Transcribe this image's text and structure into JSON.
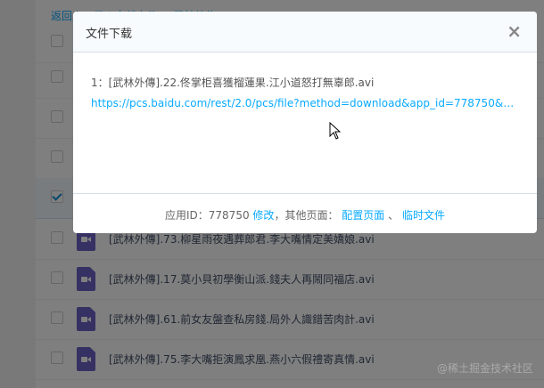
{
  "breadcrumb": "返回上一级 | 全部文件 > 武林外传",
  "rows": [
    {
      "name": "",
      "checked": false
    },
    {
      "name": "",
      "checked": false
    },
    {
      "name": "",
      "checked": false
    },
    {
      "name": "",
      "checked": false
    },
    {
      "name": "",
      "checked": true
    },
    {
      "name": "[武林外傳].73.柳星雨夜遇葬郎君.李大嘴情定美嬌娘.avi",
      "checked": false
    },
    {
      "name": "[武林外傳].17.莫小貝初學衡山派.錢夫人再鬧同福店.avi",
      "checked": false
    },
    {
      "name": "[武林外傳].61.前女友盤查私房錢.局外人識錯苦肉計.avi",
      "checked": false
    },
    {
      "name": "[武林外傳].75.李大嘴拒演鳳求凰.燕小六假禮寄真情.avi",
      "checked": false
    }
  ],
  "modal": {
    "title": "文件下载",
    "close": "×",
    "file_line": "1：[武林外傳].22.佟掌柜喜獲榴蓮果.江小道怒打無辜郎.avi",
    "link": "https://pcs.baidu.com/rest/2.0/pcs/file?method=download&app_id=778750&filename=...",
    "footer": {
      "appid_label": "应用ID：778750",
      "modify": "修改",
      "other_label": "，其他页面：",
      "config": "配置页面",
      "sep": "、",
      "temp": "临时文件"
    }
  },
  "watermark": "@稀土掘金技术社区",
  "colors": {
    "accent": "#09aaff",
    "file_icon": "#6b62c7"
  }
}
